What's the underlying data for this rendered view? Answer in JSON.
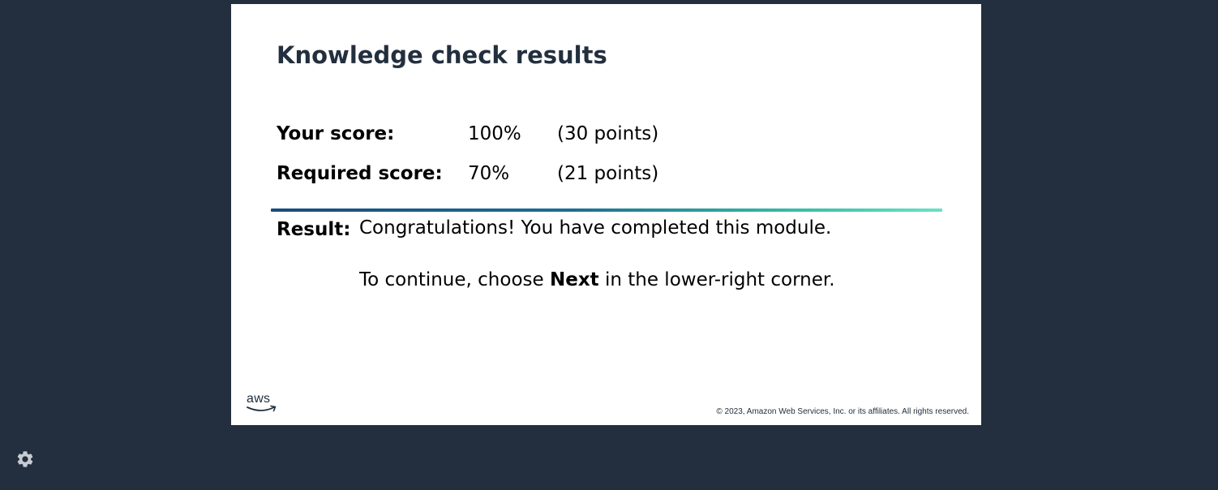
{
  "slide": {
    "title": "Knowledge check results",
    "your_score": {
      "label": "Your score:",
      "percent": "100%",
      "points": "(30 points)"
    },
    "required_score": {
      "label": "Required score:",
      "percent": "70%",
      "points": "(21 points)"
    },
    "result": {
      "label": "Result:",
      "message": "Congratulations! You have completed this module.",
      "continue_prefix": "To continue, choose ",
      "continue_bold": "Next",
      "continue_suffix": " in the lower-right corner."
    },
    "logo_text": "aws",
    "copyright": "© 2023, Amazon Web Services, Inc. or its affiliates. All rights reserved."
  },
  "player": {
    "settings_icon": "gear-icon"
  },
  "colors": {
    "background": "#232e3e",
    "slide": "#ffffff",
    "title": "#232f3e",
    "divider_start": "#1b4b79",
    "divider_end": "#6ee0c3"
  }
}
